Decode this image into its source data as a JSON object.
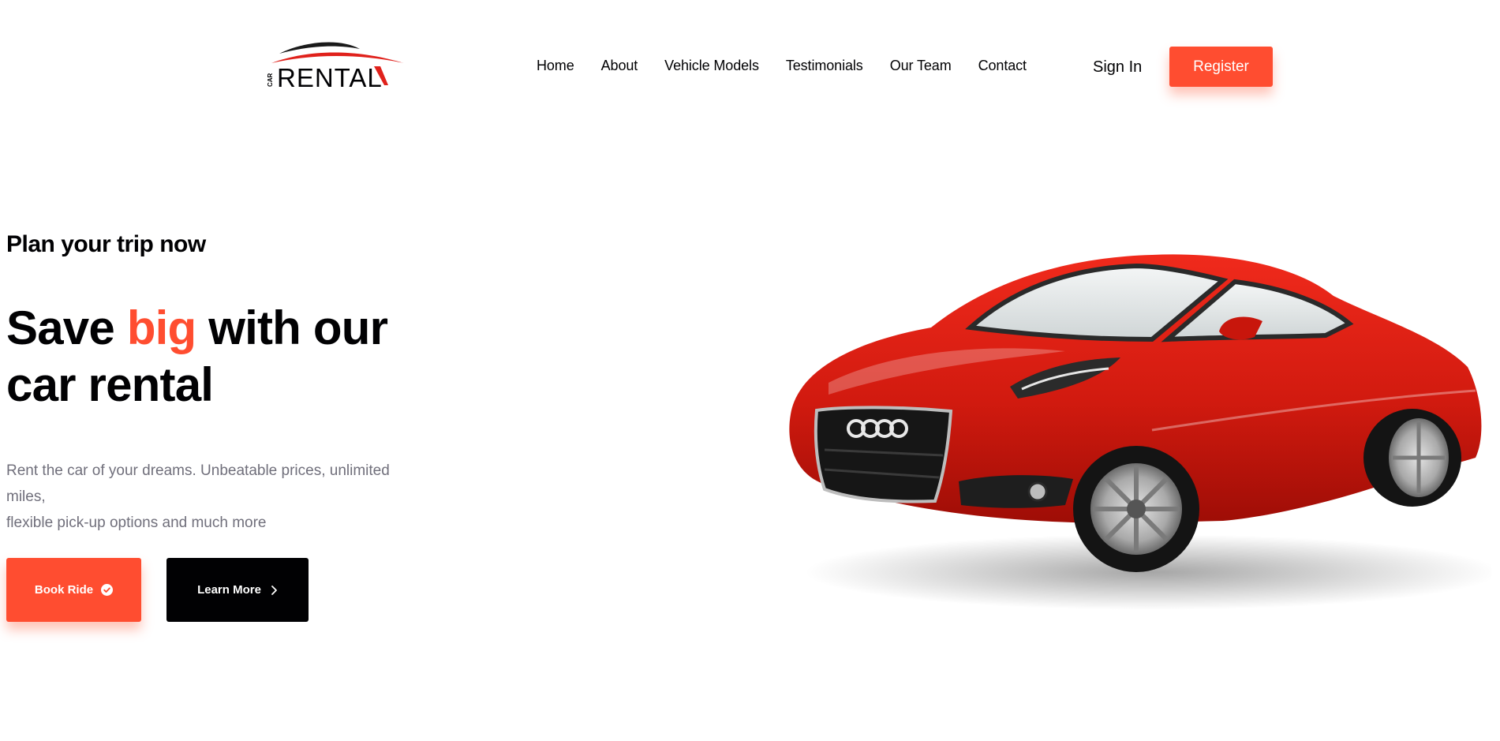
{
  "header": {
    "logo": {
      "small_text": "CAR",
      "main_text": "RENTAL",
      "colors": {
        "swoosh_dark": "#1a1a1a",
        "swoosh_red": "#e0211b",
        "text": "#010103"
      }
    },
    "nav": [
      {
        "label": "Home"
      },
      {
        "label": "About"
      },
      {
        "label": "Vehicle Models"
      },
      {
        "label": "Testimonials"
      },
      {
        "label": "Our Team"
      },
      {
        "label": "Contact"
      }
    ],
    "sign_in_label": "Sign In",
    "register_label": "Register"
  },
  "hero": {
    "subtitle": "Plan your trip now",
    "title_part1": "Save ",
    "title_accent": "big",
    "title_part2": " with our",
    "title_line2": "car rental",
    "description_line1": "Rent the car of your dreams. Unbeatable prices, unlimited miles,",
    "description_line2": "flexible pick-up options and much more",
    "book_button_label": "Book Ride",
    "book_button_icon": "check-circle-icon",
    "learn_button_label": "Learn More",
    "learn_button_icon": "chevron-right-icon"
  },
  "colors": {
    "accent": "#ff4d30",
    "text_dark": "#010103",
    "text_muted": "#706f7b",
    "car_red": "#d81c10"
  }
}
